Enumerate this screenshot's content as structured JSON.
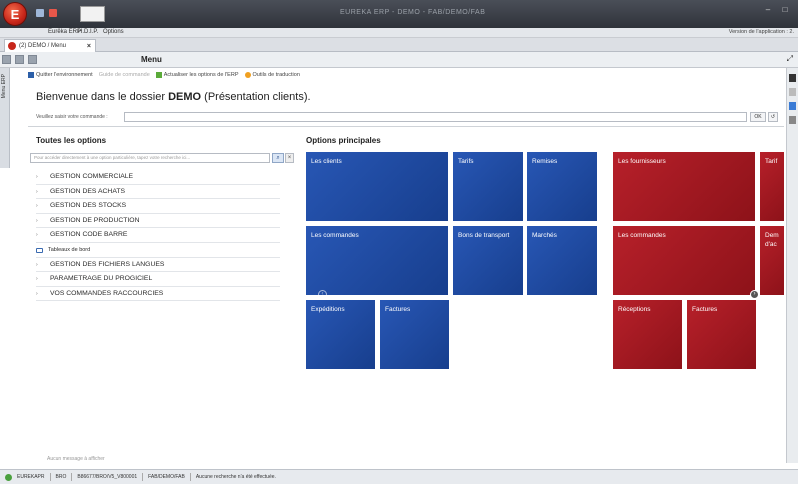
{
  "window": {
    "title": "EUREKA ERP - DEMO - FAB/DEMO/FAB"
  },
  "menubar": {
    "items": [
      "Eurêka ERP",
      "H.D.I.P.",
      "Options"
    ],
    "version": "Version de l'application : 2."
  },
  "doctab": {
    "label": "(2) DEMO / Menu"
  },
  "toolbar": {
    "title": "Menu"
  },
  "lefttab": {
    "label": "Menu ERP"
  },
  "actions": {
    "quit": "Quitter l'environnement",
    "guide": "Guide de commande",
    "update": "Actualiser les options de l'ERP",
    "translate": "Outils de traduction"
  },
  "welcome": {
    "prefix": "Bienvenue dans le dossier",
    "folder": "DEMO",
    "suffix": "(Présentation clients)."
  },
  "command": {
    "label": "Veuillez saisir votre commande :",
    "ok": "OK"
  },
  "left_panel": {
    "title": "Toutes les options",
    "search_placeholder": "Pour accéder directement à une option particulière, tapez votre recherche ici...",
    "items": [
      "GESTION COMMERCIALE",
      "GESTION DES ACHATS",
      "GESTION DES STOCKS",
      "GESTION DE PRODUCTION",
      "GESTION CODE BARRE",
      "Tableaux de bord",
      "GESTION DES FICHIERS LANGUES",
      "PARAMETRAGE DU PROGICIEL",
      "VOS COMMANDES RACCOURCIES"
    ]
  },
  "right_panel": {
    "title": "Options principales",
    "blue_tiles": [
      "Les clients",
      "Tarifs",
      "Remises",
      "Les commandes",
      "Bons de transport",
      "Marchés",
      "Expéditions",
      "Factures"
    ],
    "red_tiles": [
      "Les fournisseurs",
      "Tarif",
      "Les commandes",
      "Dem d'ac",
      "Réceptions",
      "Factures"
    ]
  },
  "messages": {
    "empty": "Aucun message à afficher"
  },
  "status": {
    "company": "EUREKAPR",
    "code": "BRO",
    "path": "B86677/BRO/V5_V800001",
    "context": "FAB/DEMO/FAB",
    "info": "Aucune recherche n'a été effectuée."
  },
  "colors": {
    "tile_blue": "#1f4aa3",
    "tile_red": "#a3191f",
    "brand": "#c7261a"
  }
}
